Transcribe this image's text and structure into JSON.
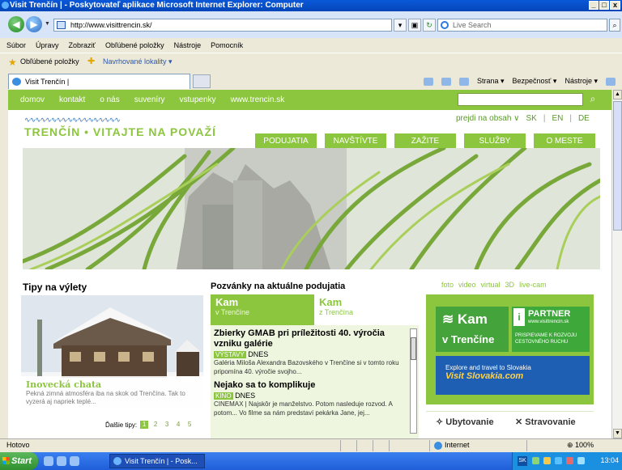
{
  "window": {
    "title": "Visit Trenčín | - Poskytovateľ aplikace Microsoft Internet Explorer: Computer",
    "controls": [
      "_",
      "□",
      "x"
    ]
  },
  "browser": {
    "address": "http://www.visittrencin.sk/",
    "search_placeholder": "Live Search",
    "menu": [
      "Súbor",
      "Úpravy",
      "Zobraziť",
      "Obľúbené položky",
      "Nástroje",
      "Pomocník"
    ],
    "favorites_label": "Obľúbené položky",
    "suggested_label": "Navrhované lokality ▾",
    "tab_title": "Visit Trenčín |",
    "command_items": [
      "Strana ▾",
      "Bezpečnosť ▾",
      "Nástroje ▾"
    ]
  },
  "site": {
    "top_nav": [
      "domov",
      "kontakt",
      "o nás",
      "suveníry",
      "vstupenky",
      "www.trencin.sk"
    ],
    "logo_waves": "∿∿∿∿∿∿∿∿∿∿∿∿∿∿∿∿∿∿",
    "logo_text": "TRENČÍN • VITAJTE NA POVAŽÍ",
    "jump_link": "prejdi na obsah ∨",
    "languages": [
      "SK",
      "EN",
      "DE"
    ],
    "main_menu": [
      "PODUJATIA",
      "NAVŠTÍVTE",
      "ZAŽITE",
      "SLUŽBY",
      "O MESTE"
    ],
    "tips": {
      "title": "Tipy na výlety",
      "caption_title": "Inovecká chata",
      "caption_text": "Pekná zimná atmosféra iba na skok od Trenčína. Tak to vyzerá aj napriek teplé...",
      "more_label": "Ďalšie tipy:",
      "pages": [
        "1",
        "2",
        "3",
        "4",
        "5"
      ]
    },
    "events": {
      "title": "Pozvánky na aktuálne podujatia",
      "tab_a": {
        "title": "Kam",
        "subtitle": "v Trenčíne"
      },
      "tab_b": {
        "title": "Kam",
        "subtitle": "z Trenčína"
      },
      "items": [
        {
          "title": "Zbierky GMAB pri príležitosti 40. výročia vzniku galérie",
          "tag": "VÝSTAVY",
          "date": "DNES",
          "text": "Galéria Miloša Alexandra Bazovského v Trenčíne si v tomto roku pripomína 40. výročie svojho..."
        },
        {
          "title": "Nejako sa to komplikuje",
          "tag": "KINO",
          "date": "DNES",
          "text": "CINEMAX | Najskôr je manželstvo. Potom nasleduje rozvod. A potom... Vo filme sa nám predstaví pekárka Jane, jej..."
        }
      ]
    },
    "media_links": [
      "foto",
      "video",
      "virtual",
      "3D",
      "live-cam"
    ],
    "kam_banner": {
      "line1": "Kam",
      "line2": "v Trenčíne"
    },
    "partner_banner": {
      "title": "PARTNER",
      "url": "www.visittrencin.sk",
      "text": "PRISPIEVAME K ROZVOJU CESTOVNÉHO RUCHU"
    },
    "slovakia_banner": {
      "line1": "Explore and travel to Slovakia",
      "line2": "Visit Slovakia.com"
    },
    "tabs": [
      "Ubytovanie",
      "Stravovanie"
    ]
  },
  "status": {
    "text": "Hotovo",
    "zone": "Internet",
    "zoom": "100%"
  },
  "taskbar": {
    "start": "Start",
    "task": "Visit Trenčín | - Posk...",
    "time": "13:04"
  }
}
